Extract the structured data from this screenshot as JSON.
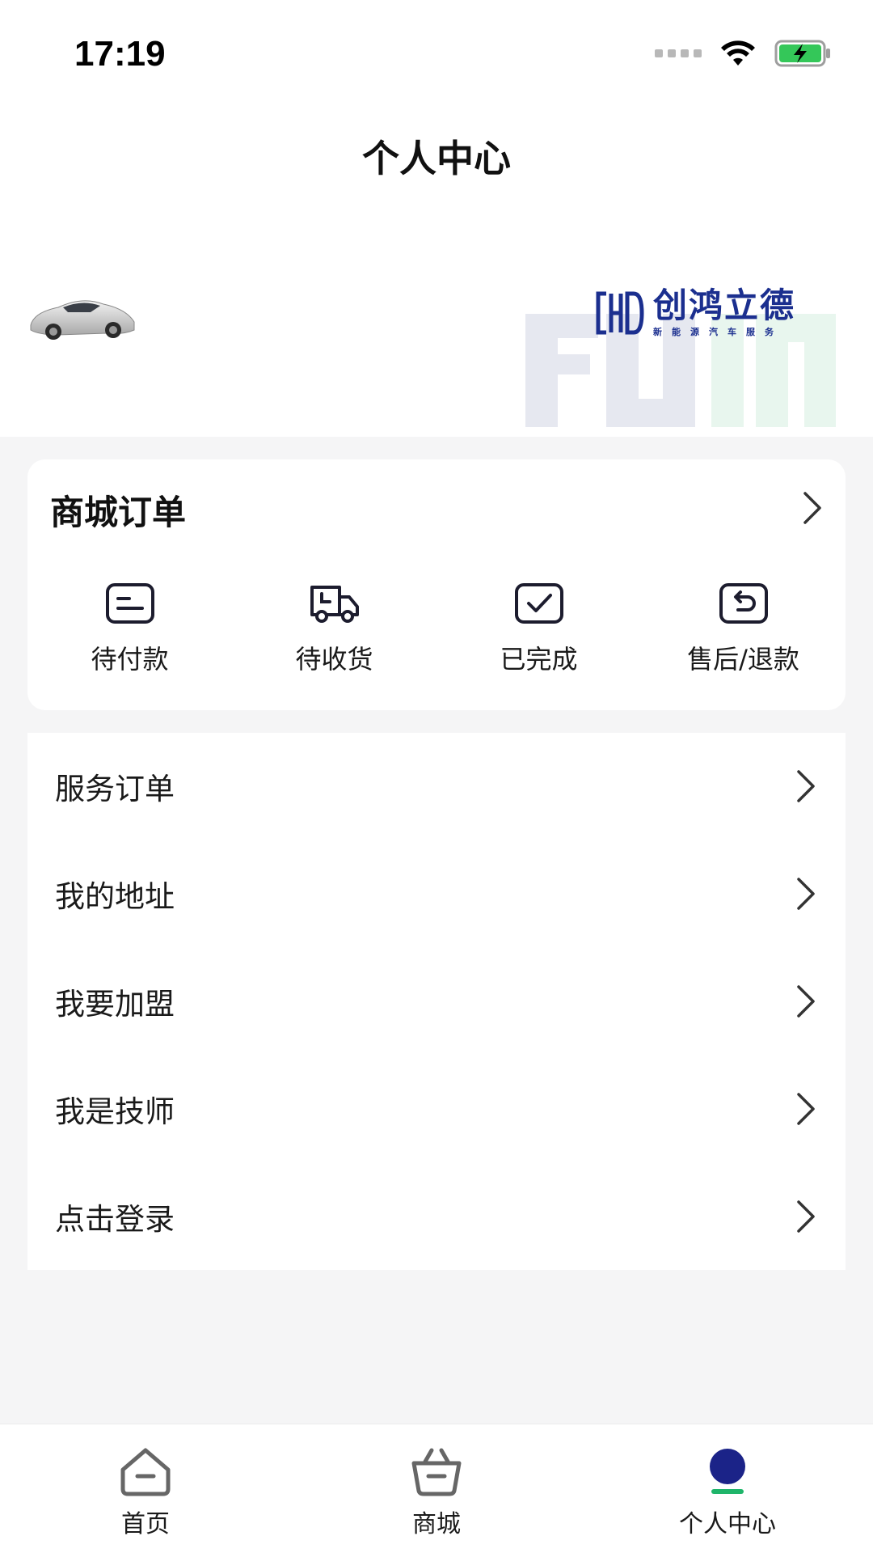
{
  "status_bar": {
    "time": "17:19"
  },
  "header": {
    "title": "个人中心"
  },
  "brand": {
    "name": "创鸿立德",
    "subtitle": "新能源汽车服务"
  },
  "orders": {
    "title": "商城订单",
    "actions": [
      {
        "label": "待付款",
        "icon": "wallet-icon"
      },
      {
        "label": "待收货",
        "icon": "truck-icon"
      },
      {
        "label": "已完成",
        "icon": "check-icon"
      },
      {
        "label": "售后/退款",
        "icon": "return-icon"
      }
    ]
  },
  "menu": {
    "items": [
      {
        "label": "服务订单"
      },
      {
        "label": "我的地址"
      },
      {
        "label": "我要加盟"
      },
      {
        "label": "我是技师"
      },
      {
        "label": "点击登录"
      }
    ]
  },
  "tabbar": {
    "tabs": [
      {
        "label": "首页"
      },
      {
        "label": "商城"
      },
      {
        "label": "个人中心"
      }
    ],
    "active_index": 2
  },
  "colors": {
    "brand_blue": "#1b2f8f",
    "active_tab": "#1b2388",
    "active_indicator": "#1fb56a",
    "watermark_gray": "#e6e8f0",
    "watermark_green": "#e8f6ee"
  }
}
